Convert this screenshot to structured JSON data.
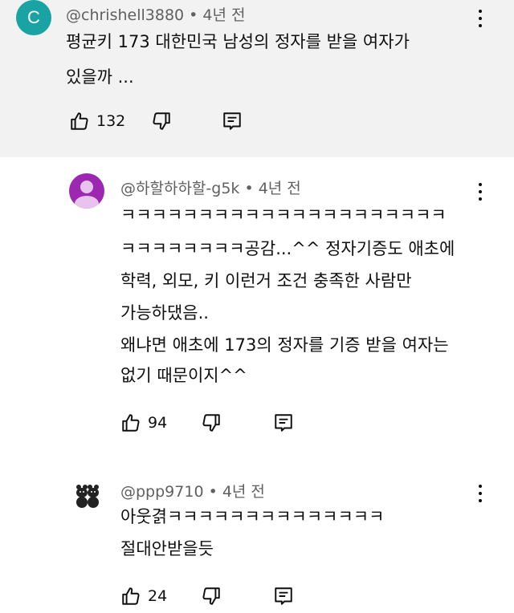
{
  "comments": [
    {
      "avatar_letter": "C",
      "avatar_color": "#1aa3a3",
      "meta": "@chrishell3880 • 4년 전",
      "lines": [
        "평균키 173 대한민국 남성의 정자를 받을 여자가",
        "있을까 ..."
      ],
      "likes": "132"
    },
    {
      "avatar_icon": "person-icon",
      "avatar_color": "#9c27b0",
      "meta": "@하할하하할-g5k • 4년 전",
      "lines": [
        "ㅋㅋㅋㅋㅋㅋㅋㅋㅋㅋㅋㅋㅋㅋㅋㅋㅋㅋㅋㅋㅋ",
        "ㅋㅋㅋㅋㅋㅋㅋㅋ공감...^^ 정자기증도 애초에",
        "학력, 외모, 키 이런거 조건 충족한 사람만",
        "가능하댔음..",
        "왜냐면 애초에 173의 정자를 기증 받을 여자는",
        "없기 때문이지^^"
      ],
      "likes": "94"
    },
    {
      "avatar_icon": "bears-icon",
      "meta": "@ppp9710 • 4년 전",
      "lines": [
        "아웃겱ㅋㅋㅋㅋㅋㅋㅋㅋㅋㅋㅋㅋㅋㅋ",
        "절대안받을듯"
      ],
      "likes": "24"
    }
  ]
}
